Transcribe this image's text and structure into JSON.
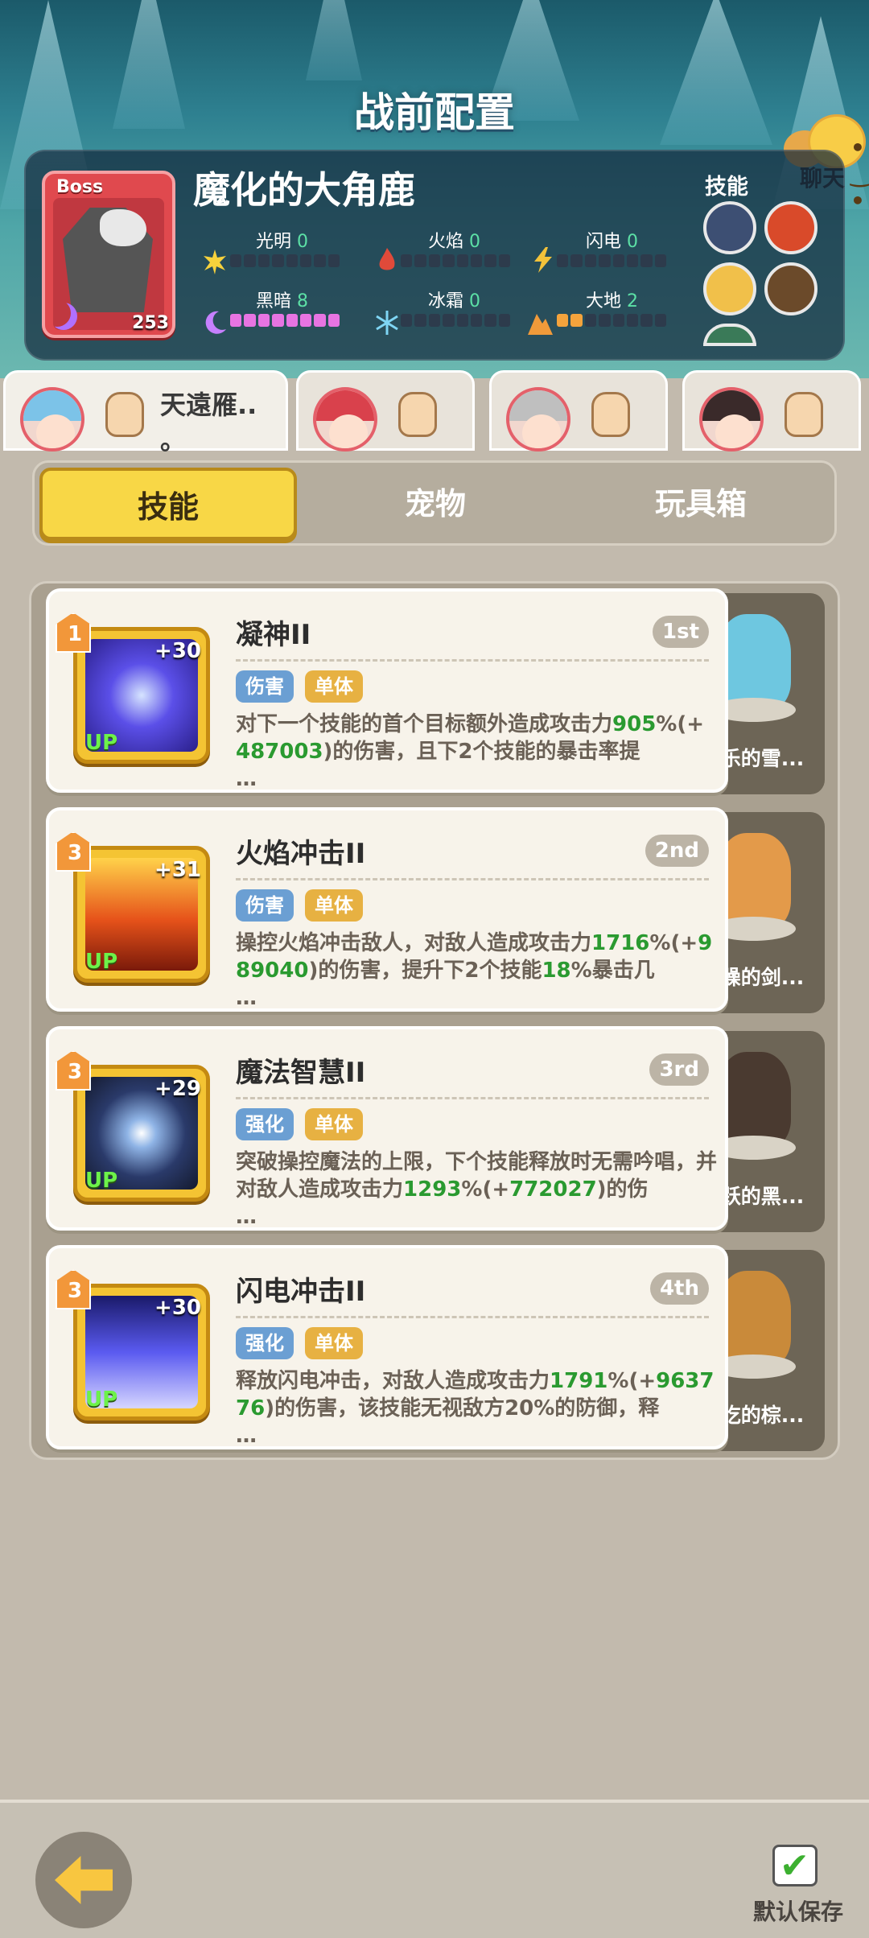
{
  "header": {
    "title": "战前配置",
    "chat_label": "聊天"
  },
  "boss": {
    "tag": "Boss",
    "level": "253",
    "name": "魔化的大角鹿",
    "skills_label": "技能",
    "elements": [
      {
        "name": "光明",
        "value": "0",
        "level": 0
      },
      {
        "name": "火焰",
        "value": "0",
        "level": 0
      },
      {
        "name": "闪电",
        "value": "0",
        "level": 0
      },
      {
        "name": "黑暗",
        "value": "8",
        "level": 8
      },
      {
        "name": "冰霜",
        "value": "0",
        "level": 0
      },
      {
        "name": "大地",
        "value": "2",
        "level": 2
      }
    ]
  },
  "party": {
    "active_name": "天遠雁..\n。"
  },
  "subtabs": [
    "技能",
    "宠物",
    "玩具箱"
  ],
  "skills": [
    {
      "rank": "1",
      "plus": "+30",
      "up": "UP",
      "name": "凝神II",
      "order": "1st",
      "tags": [
        "伤害",
        "单体"
      ],
      "desc_parts": [
        "对下一个技能的首个目标额外造成攻击力",
        "905",
        "%(+",
        "487003",
        ")的伤害，且下2个技能的暴击率提",
        "…"
      ],
      "pet": "快乐的雪..."
    },
    {
      "rank": "3",
      "plus": "+31",
      "up": "UP",
      "name": "火焰冲击II",
      "order": "2nd",
      "tags": [
        "伤害",
        "单体"
      ],
      "desc_parts": [
        "操控火焰冲击敌人，对敌人造成攻击力",
        "1716",
        "%(+",
        "989040",
        ")的伤害，提升下2个技能",
        "18",
        "%暴击几",
        "…"
      ],
      "pet": "暴躁的剑..."
    },
    {
      "rank": "3",
      "plus": "+29",
      "up": "UP",
      "name": "魔法智慧II",
      "order": "3rd",
      "tags": [
        "强化",
        "单体"
      ],
      "desc_parts": [
        "突破操控魔法的上限，下个技能释放时无需吟唱，并对敌人造成攻击力",
        "1293",
        "%(+",
        "772027",
        ")的伤",
        "…"
      ],
      "pet": "活跃的黑..."
    },
    {
      "rank": "3",
      "plus": "+30",
      "up": "UP",
      "name": "闪电冲击II",
      "order": "4th",
      "tags": [
        "强化",
        "单体"
      ],
      "desc_parts": [
        "释放闪电冲击，对敌人造成攻击力",
        "1791",
        "%(+",
        "963776",
        ")的伤害，该技能无视敌方20%的防御，释",
        "…"
      ],
      "pet": "贪吃的棕..."
    }
  ],
  "footer": {
    "save_label": "默认保存"
  },
  "colors": {
    "tag_damage": "#6b9fd3",
    "tag_single": "#e7b142",
    "tag_buff": "#6b9fd3",
    "accent_yellow": "#f8d746",
    "highlight_green": "#2a9a30"
  }
}
